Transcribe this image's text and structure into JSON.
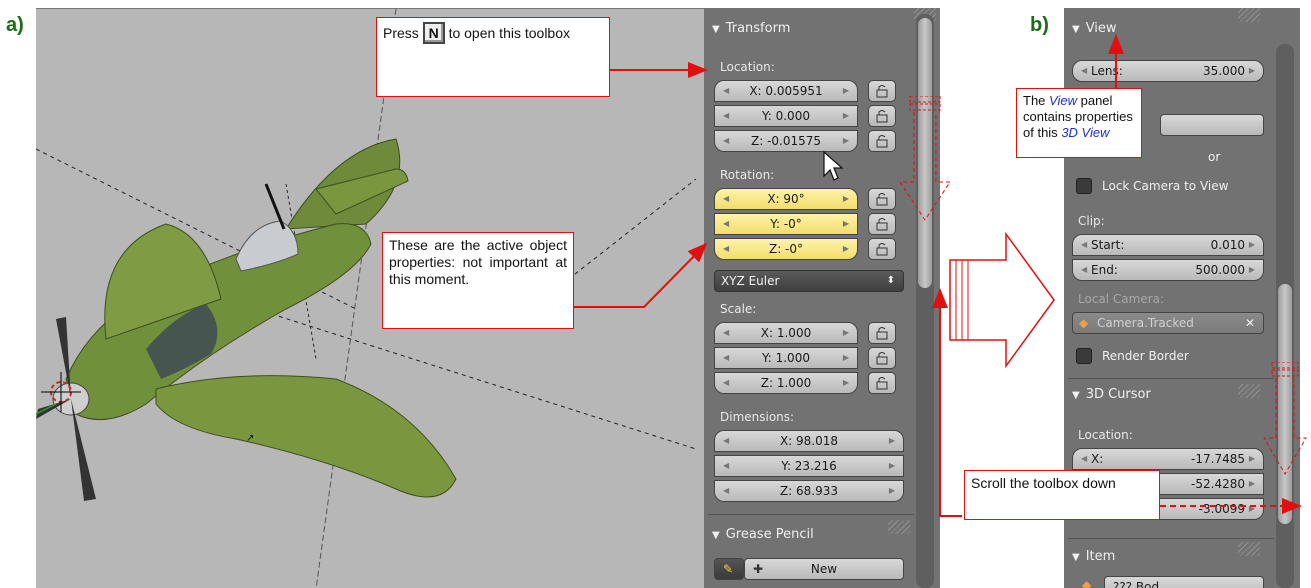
{
  "labels": {
    "a": "a)",
    "b": "b)"
  },
  "panel_a": {
    "transform_header": "Transform",
    "location_label": "Location:",
    "location": {
      "x": "X: 0.005951",
      "y": "Y: 0.000",
      "z": "Z: -0.01575"
    },
    "rotation_label": "Rotation:",
    "rotation": {
      "x": "X: 90°",
      "y": "Y: -0°",
      "z": "Z: -0°"
    },
    "rotation_mode": "XYZ Euler",
    "scale_label": "Scale:",
    "scale": {
      "x": "X: 1.000",
      "y": "Y: 1.000",
      "z": "Z: 1.000"
    },
    "dimensions_label": "Dimensions:",
    "dimensions": {
      "x": "X: 98.018",
      "y": "Y: 23.216",
      "z": "Z: 68.933"
    },
    "grease_pencil_header": "Grease Pencil",
    "new_button": "New"
  },
  "panel_b": {
    "view_header": "View",
    "lens_label": "Lens:",
    "lens_value": "35.000",
    "partial_text": "or",
    "lock_camera_label": "Lock Camera to View",
    "clip_label": "Clip:",
    "clip_start_label": "Start:",
    "clip_start_value": "0.010",
    "clip_end_label": "End:",
    "clip_end_value": "500.000",
    "local_camera_label": "Local Camera:",
    "local_camera_value": "Camera.Tracked",
    "render_border_label": "Render Border",
    "cursor_header": "3D Cursor",
    "cursor_location_label": "Location:",
    "cursor_x_label": "X:",
    "cursor_x": "-17.7485",
    "cursor_y": "-52.4280",
    "cursor_z": "-3.0099",
    "item_header": "Item",
    "item_field_partial": "??? Bod..."
  },
  "callouts": {
    "press_pre": "Press",
    "press_key": "N",
    "press_post": "to open this toolbox",
    "active_props": "These are the active object properties: not important at this moment.",
    "scroll": "Scroll the toolbox down",
    "view_pre": "The",
    "view_em1": "View",
    "view_mid": "panel contains properties of this",
    "view_em2": "3D View"
  },
  "colors": {
    "accent_red": "#e01010",
    "emphasis_blue": "#1a2fd0",
    "label_green": "#1a6b1a",
    "active_field": "#f6e88a"
  }
}
